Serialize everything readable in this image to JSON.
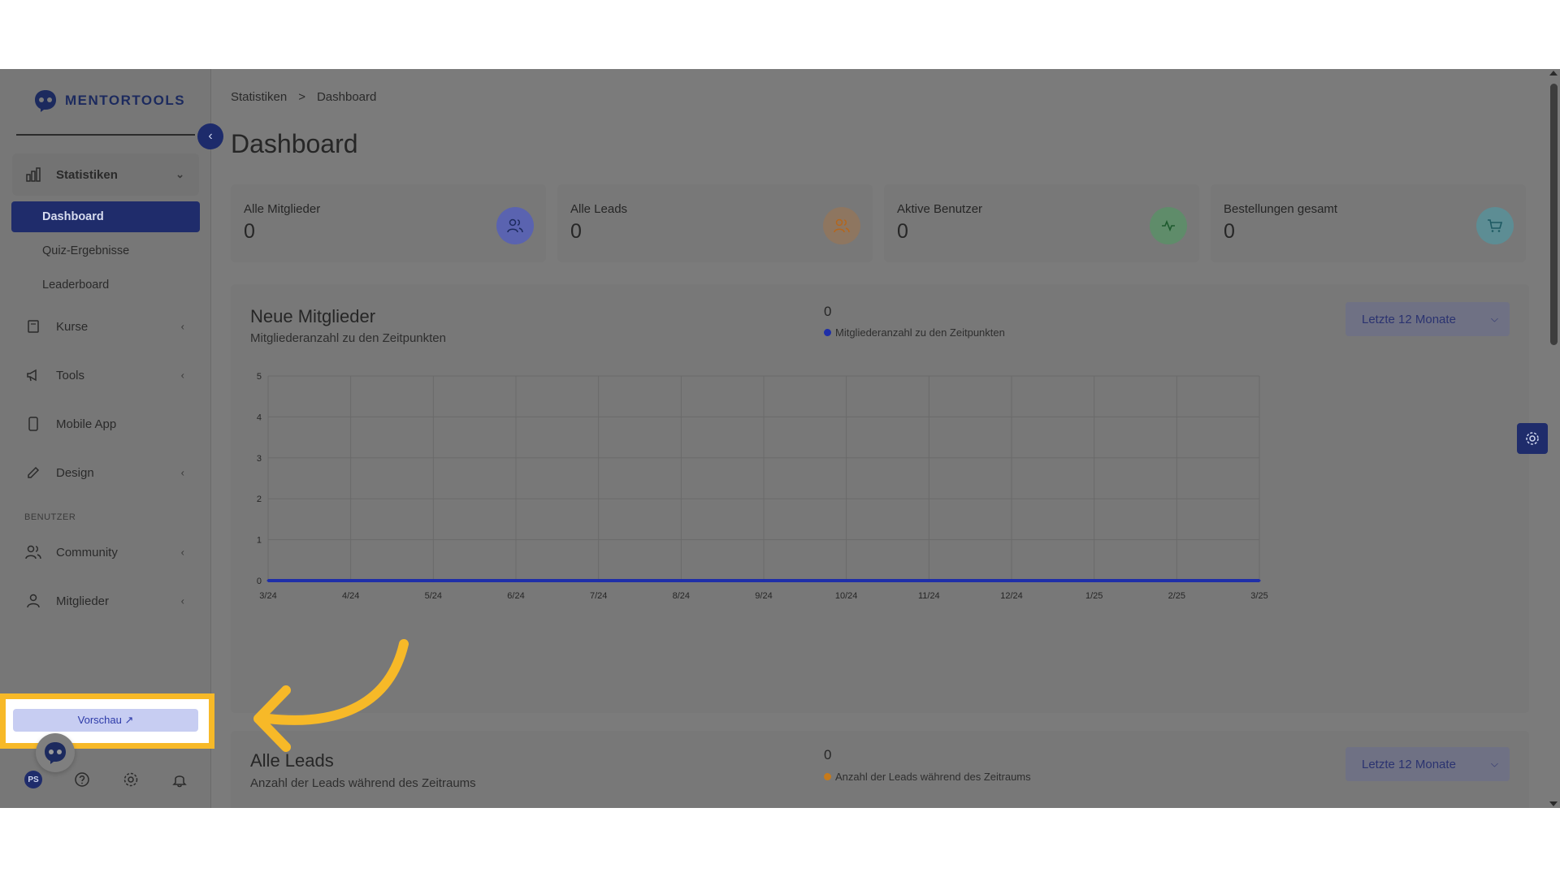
{
  "brand": {
    "name": "MENTORTOOLS"
  },
  "sidebar": {
    "groups": [
      {
        "label": "Statistiken",
        "icon": "bar-chart-icon",
        "chevron": "⌄"
      },
      {
        "label": "Kurse",
        "icon": "book-icon",
        "chevron": "‹"
      },
      {
        "label": "Tools",
        "icon": "megaphone-icon",
        "chevron": "‹"
      },
      {
        "label": "Mobile App",
        "icon": "phone-icon"
      },
      {
        "label": "Design",
        "icon": "edit-icon",
        "chevron": "‹"
      },
      {
        "label": "Community",
        "icon": "users-icon",
        "chevron": "‹"
      },
      {
        "label": "Mitglieder",
        "icon": "user-icon",
        "chevron": "‹"
      }
    ],
    "sub_items": [
      {
        "label": "Dashboard",
        "active": true
      },
      {
        "label": "Quiz-Ergebnisse"
      },
      {
        "label": "Leaderboard"
      }
    ],
    "section_label": "BENUTZER",
    "preview_button": "Vorschau ↗",
    "user_initials": "PS"
  },
  "breadcrumb": {
    "root": "Statistiken",
    "separator": ">",
    "current": "Dashboard"
  },
  "page_title": "Dashboard",
  "stats": [
    {
      "label": "Alle Mitglieder",
      "value": "0",
      "icon": "users-icon",
      "color": "#5a63b0"
    },
    {
      "label": "Alle Leads",
      "value": "0",
      "icon": "users-icon",
      "color": "#9a7a5a"
    },
    {
      "label": "Aktive Benutzer",
      "value": "0",
      "icon": "activity-icon",
      "color": "#4f8a5e"
    },
    {
      "label": "Bestellungen gesamt",
      "value": "0",
      "icon": "cart-icon",
      "color": "#4f8a92"
    }
  ],
  "panels": [
    {
      "title": "Neue Mitglieder",
      "subtitle": "Mitgliederanzahl zu den Zeitpunkten",
      "count": "0",
      "legend": "Mitgliederanzahl zu den Zeitpunkten",
      "legend_color": "#1f2fa8",
      "range": "Letzte 12 Monate"
    },
    {
      "title": "Alle Leads",
      "subtitle": "Anzahl der Leads während des Zeitraums",
      "count": "0",
      "legend": "Anzahl der Leads während des Zeitraums",
      "legend_color": "#c77a1a",
      "range": "Letzte 12 Monate"
    }
  ],
  "chart_data": {
    "type": "line",
    "categories": [
      "3/24",
      "4/24",
      "5/24",
      "6/24",
      "7/24",
      "8/24",
      "9/24",
      "10/24",
      "11/24",
      "12/24",
      "1/25",
      "2/25",
      "3/25"
    ],
    "series": [
      {
        "name": "Mitgliederanzahl zu den Zeitpunkten",
        "values": [
          0,
          0,
          0,
          0,
          0,
          0,
          0,
          0,
          0,
          0,
          0,
          0,
          0
        ]
      }
    ],
    "ylim": [
      0,
      5
    ],
    "yticks": [
      0,
      1,
      2,
      3,
      4,
      5
    ],
    "grid": true,
    "color": "#1f2fa8"
  },
  "colors": {
    "accent": "#1f2c6b",
    "highlight": "#f7b928",
    "overlay": "#7b7b7b"
  }
}
